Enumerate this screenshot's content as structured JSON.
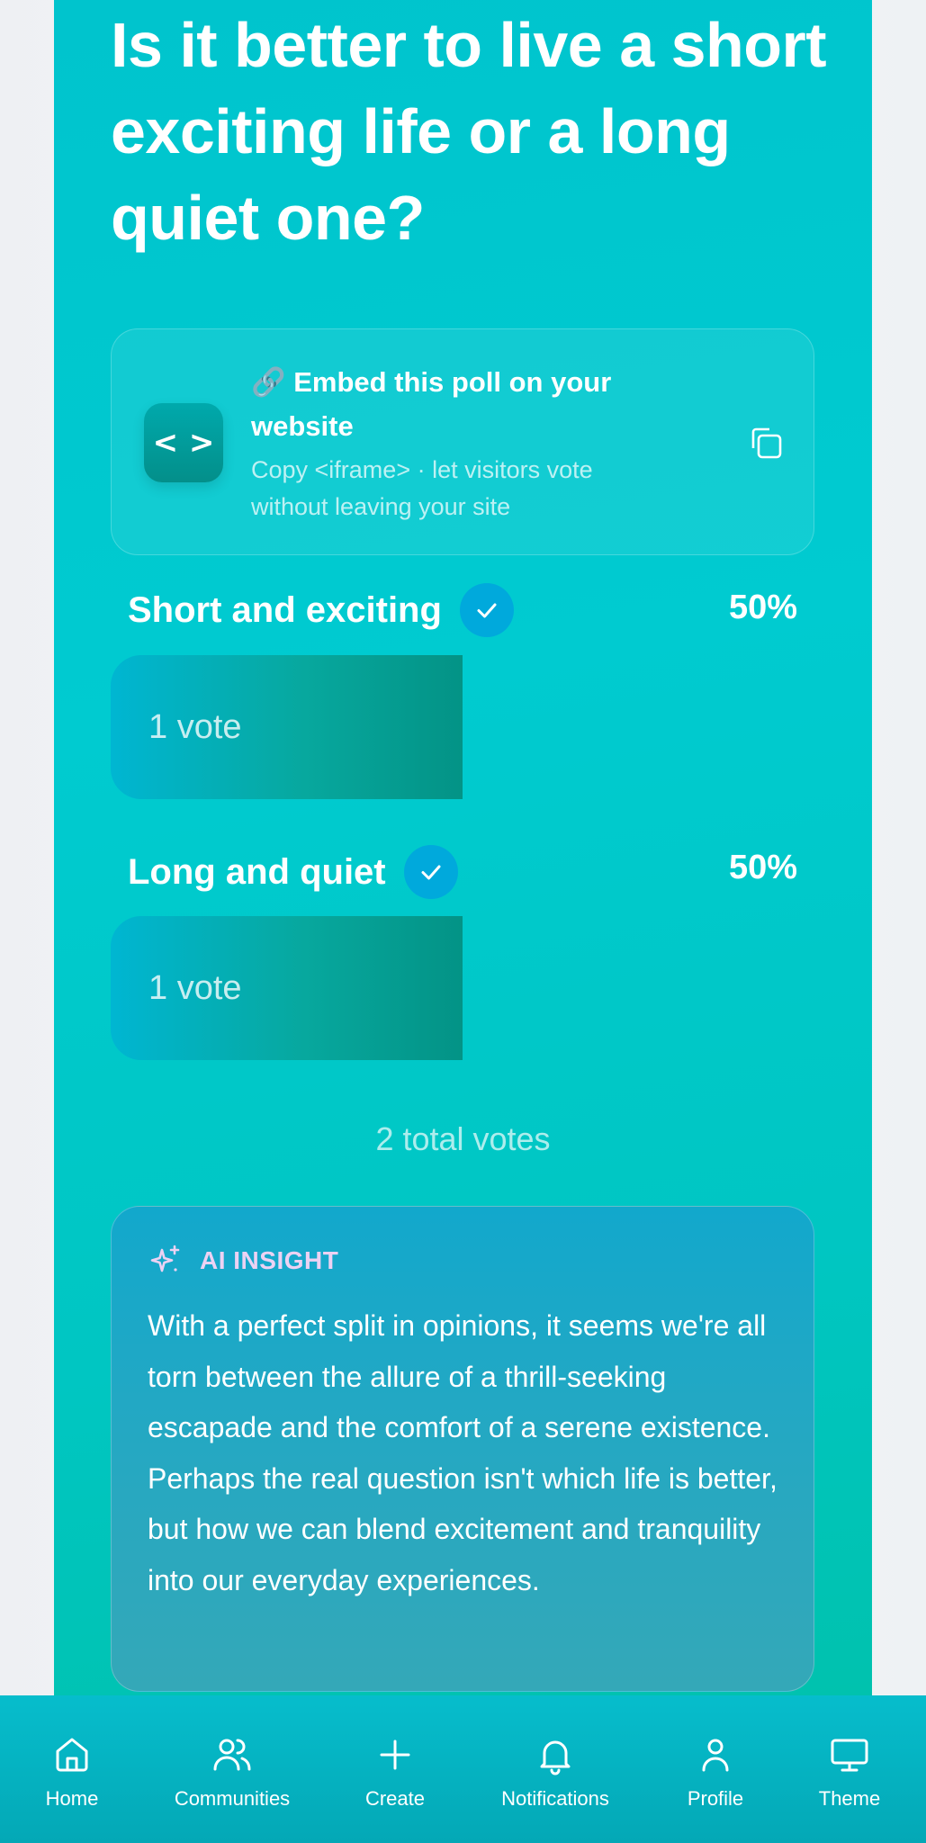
{
  "poll": {
    "question": "Is it better to live a short exciting life or a long quiet one?",
    "total_votes": "2 total votes"
  },
  "embed": {
    "title": "🔗 Embed this poll on your website",
    "subtitle": "Copy <iframe> · let visitors vote without leaving your site",
    "icon_glyph": "< >"
  },
  "options": [
    {
      "label": "Short and exciting",
      "percent": "50%",
      "votes_label": "1 vote",
      "share": 0.5,
      "selected": true
    },
    {
      "label": "Long and quiet",
      "percent": "50%",
      "votes_label": "1 vote",
      "share": 0.5,
      "selected": true
    }
  ],
  "insight": {
    "heading": "AI INSIGHT",
    "text": "With a perfect split in opinions, it seems we're all torn between the allure of a thrill-seeking escapade and the comfort of a serene existence. Perhaps the real question isn't which life is better, but how we can blend excitement and tranquility into our everyday experiences."
  },
  "nav": {
    "items": [
      {
        "label": "Home",
        "icon": "home-icon"
      },
      {
        "label": "Communities",
        "icon": "users-icon"
      },
      {
        "label": "Create",
        "icon": "plus-icon"
      },
      {
        "label": "Notifications",
        "icon": "bell-icon"
      },
      {
        "label": "Profile",
        "icon": "user-icon"
      },
      {
        "label": "Theme",
        "icon": "monitor-icon"
      }
    ]
  },
  "colors": {
    "card": "#00c8ce",
    "bar_fill_start": "#00b6d2",
    "bar_fill_end": "#039386",
    "check": "#00a9dc",
    "insight_heading": "#ecd2f3",
    "nav": "#05b3c2"
  }
}
